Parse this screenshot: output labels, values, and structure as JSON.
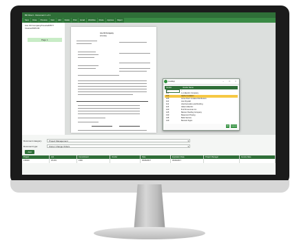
{
  "window": {
    "title": "Bill Direct - Document 1 of 1"
  },
  "ribbon": [
    "Save",
    "Close",
    "Previous",
    "Next",
    "Add",
    "Delete",
    "Print",
    "Email",
    "Workflow",
    "Route",
    "Approve",
    "Reject"
  ],
  "tree": {
    "header": "Ace Oil Company/Invoice#4577 Invoice/2015-03",
    "page_label": "Page 1"
  },
  "invoice": {
    "company": "Ace Oil Company",
    "doc_type": "INVOICE"
  },
  "fields": {
    "category_label": "Document category:",
    "category_value": "Project Management",
    "type_label": "Document type:",
    "type_value": "Owner Change Orders"
  },
  "add_label": "Add",
  "grid": {
    "columns": [
      "Project",
      "Job",
      "Commitment",
      "Vendor",
      "Date",
      "Expiration Date",
      "Project Manager",
      "Invoice Date"
    ],
    "rows": [
      [
        "215000",
        "25-001",
        "2150",
        "",
        "05/26/2017",
        "05/26/2017",
        "",
        ""
      ]
    ]
  },
  "dialog": {
    "title": "Lookup",
    "columns": [
      "Vendor",
      "Vendor Name"
    ],
    "search_value": "2",
    "rows": [
      [
        "101",
        "A-1 Electric Company"
      ],
      [
        "103",
        "Alpha Insulation"
      ],
      [
        "105",
        "Acme Door & Glass Distributors"
      ],
      [
        "110",
        "Ace Drywall"
      ],
      [
        "112",
        "AAA Acoustics and Roofing"
      ],
      [
        "115",
        "Adams Electric"
      ],
      [
        "120",
        "B & B Concrete Inc."
      ],
      [
        "125",
        "Banner Roofing Company"
      ],
      [
        "130",
        "Beaumont Paving"
      ],
      [
        "135",
        "Bells Service"
      ],
      [
        "140",
        "Bennett Signs"
      ]
    ],
    "selected_index": 1,
    "ok_label": "OK",
    "cancel_label": "Cancel"
  },
  "colors": {
    "accent": "#2f6f38",
    "selection": "#f6c843",
    "tree_selection": "#c8ecc6"
  }
}
